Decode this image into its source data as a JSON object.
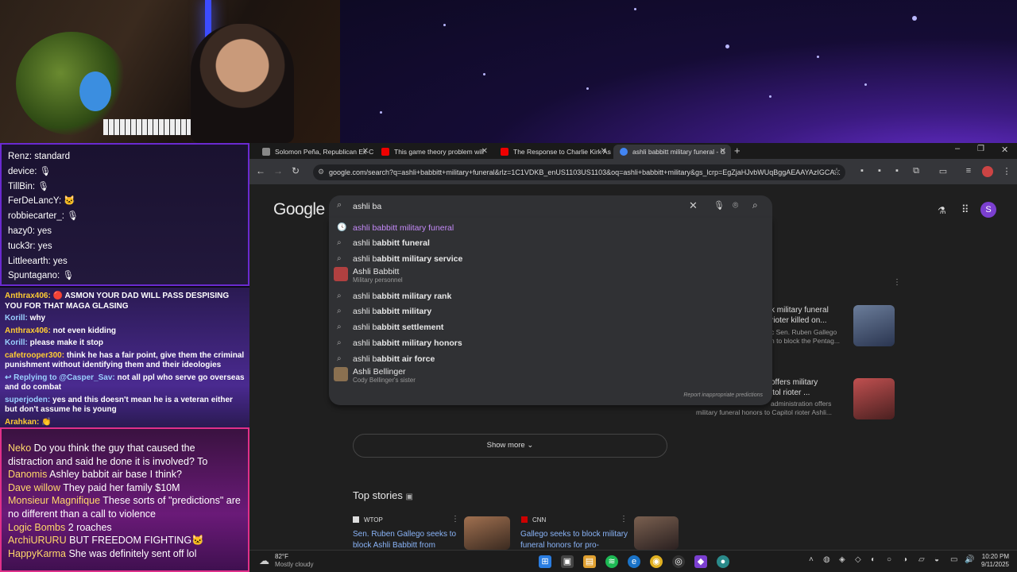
{
  "chat_top": [
    {
      "name": "Renz",
      "msg": "standard"
    },
    {
      "name": "device",
      "msg": "🎙"
    },
    {
      "name": "TillBin",
      "msg": "🎙"
    },
    {
      "name": "FerDeLancY",
      "msg": "🐱"
    },
    {
      "name": "robbiecarter_",
      "msg": "🎙"
    },
    {
      "name": "hazy0",
      "msg": "yes"
    },
    {
      "name": "tuck3r",
      "msg": "yes"
    },
    {
      "name": "Littleearth",
      "msg": "yes"
    },
    {
      "name": "Spuntagano",
      "msg": "🎙"
    }
  ],
  "chat_mid": [
    {
      "name": "Anthrax406:",
      "msg": "🔴 ASMON YOUR DAD WILL PASS DESPISING YOU FOR THAT MAGA GLASING",
      "blue": false
    },
    {
      "name": "Korill:",
      "msg": "why",
      "blue": true
    },
    {
      "name": "Anthrax406:",
      "msg": "not even kidding",
      "blue": false
    },
    {
      "name": "Korill:",
      "msg": "please make it stop",
      "blue": true
    },
    {
      "name": "cafetrooper300:",
      "msg": "think he has a fair point, give them the criminal punishment without identifying them and their ideologies",
      "blue": false
    },
    {
      "name": "↩ Replying to @Casper_Sav:",
      "msg": "not all ppl who serve go overseas and do combat",
      "blue": true
    },
    {
      "name": "superjoden:",
      "msg": "yes and this doesn't mean he is a veteran either but don't assume he is young",
      "blue": true
    },
    {
      "name": "Arahkan:",
      "msg": "👏",
      "blue": false
    }
  ],
  "chat_bottom": [
    {
      "name": "Neko",
      "msg": "Do you think the guy that caused the distraction and said he done it is involved? To"
    },
    {
      "name": "Danomis",
      "msg": "Ashley babbit air base I think?"
    },
    {
      "name": "Dave willow",
      "msg": "They paid her family $10M"
    },
    {
      "name": "Monsieur Magnifique",
      "msg": "These sorts of \"predictions\" are no different than a call to violence"
    },
    {
      "name": "Logic Bombs",
      "msg": "2 roaches"
    },
    {
      "name": "ArchiURURU",
      "msg": "BUT FREEDOM FIGHTING🐱"
    },
    {
      "name": "HappyKarma",
      "msg": "She was definitely sent off lol"
    }
  ],
  "tabs": [
    {
      "label": "Solomon Peña, Republican Ex-C",
      "color": "#888"
    },
    {
      "label": "This game theory problem will",
      "color": "#e00"
    },
    {
      "label": "The Response to Charlie Kirk As",
      "color": "#e00"
    },
    {
      "label": "ashli babbitt military funeral - G",
      "color": "#4285f4"
    }
  ],
  "url": "google.com/search?q=ashli+babbitt+military+funeral&rlz=1C1VDKB_enUS1103US1103&oq=ashli+babbitt+military&gs_lcrp=EgZjaHJvbWUqBggAEAAYAzIGCA...",
  "search": {
    "logo": "Google",
    "query": "ashli ba"
  },
  "suggestions": [
    {
      "prefix": "ashli b",
      "rest": "abbitt military funeral",
      "type": "history"
    },
    {
      "prefix": "ashli b",
      "rest": "abbitt funeral",
      "type": "search"
    },
    {
      "prefix": "ashli b",
      "rest": "abbitt military service",
      "type": "search"
    },
    {
      "prefix": "",
      "rest": "Ashli Babbitt",
      "sub": "Military personnel",
      "type": "entity"
    },
    {
      "prefix": "ashli b",
      "rest": "abbitt military rank",
      "type": "search"
    },
    {
      "prefix": "ashli b",
      "rest": "abbitt military",
      "type": "search"
    },
    {
      "prefix": "ashli b",
      "rest": "abbitt settlement",
      "type": "search"
    },
    {
      "prefix": "ashli b",
      "rest": "abbitt military honors",
      "type": "search"
    },
    {
      "prefix": "ashli b",
      "rest": "abbitt air force",
      "type": "search"
    },
    {
      "prefix": "",
      "rest": "Ashli Bellinger",
      "sub": "Cody Bellinger's sister",
      "type": "entity"
    }
  ],
  "report_text": "Report inappropriate predictions",
  "right_cards": [
    {
      "line1": "k military funeral",
      "line2": "rioter killed on...",
      "sub1": "c Sen. Ruben Gallego",
      "sub2": "n to block the Pentag..."
    },
    {
      "line1": "offers military",
      "line2": "itol rioter ...",
      "sub1": "administration offers",
      "sub2": "military funeral honors to Capitol rioter Ashli..."
    }
  ],
  "show_more": "Show more",
  "top_stories": "Top stories",
  "stories": [
    {
      "source": "WTOP",
      "title": "Sen. Ruben Gallego seeks to block Ashli Babbitt from"
    },
    {
      "source": "CNN",
      "title": "Gallego seeks to block military funeral honors for pro-"
    }
  ],
  "weather": {
    "temp": "82°F",
    "desc": "Mostly cloudy"
  },
  "clock": {
    "time": "10:20 PM",
    "date": "9/11/2025"
  },
  "profile_initial": "S"
}
